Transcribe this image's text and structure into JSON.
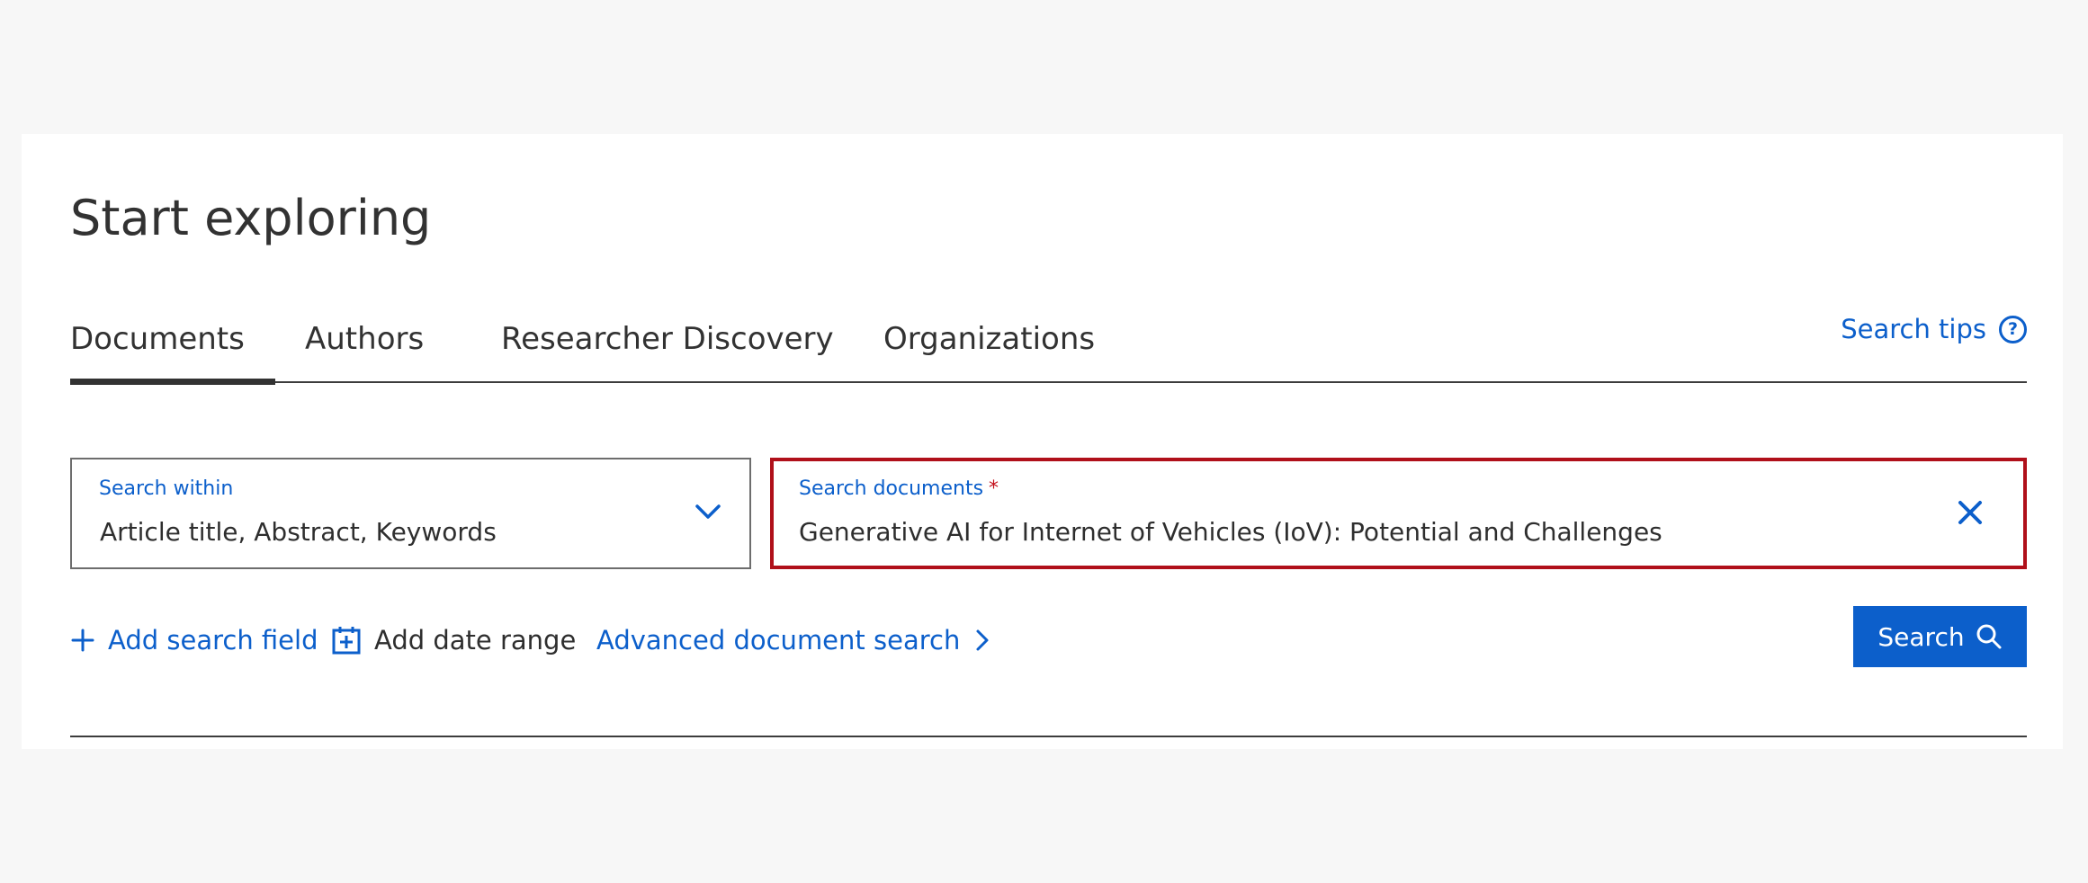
{
  "page": {
    "title": "Start exploring"
  },
  "tabs": [
    {
      "label": "Documents",
      "active": true
    },
    {
      "label": "Authors",
      "active": false
    },
    {
      "label": "Researcher Discovery",
      "active": false
    },
    {
      "label": "Organizations",
      "active": false
    }
  ],
  "search_tips": {
    "label": "Search tips",
    "icon": "help-circle-icon"
  },
  "search_within": {
    "label": "Search within",
    "value": "Article title, Abstract, Keywords",
    "icon": "chevron-down-icon"
  },
  "search_documents": {
    "label": "Search documents",
    "required_mark": "*",
    "value": "Generative AI for Internet of Vehicles (IoV): Potential and Challenges",
    "icon": "close-icon"
  },
  "actions": {
    "add_search_field": "Add search field",
    "add_date_range": "Add date range",
    "advanced_search": "Advanced document search"
  },
  "search_button": {
    "label": "Search",
    "icon": "search-icon"
  },
  "colors": {
    "accent": "#0c5fcb",
    "focus_border": "#b0101a",
    "required": "#c4101c",
    "text": "#2e2e2e",
    "background": "#f7f7f7"
  }
}
